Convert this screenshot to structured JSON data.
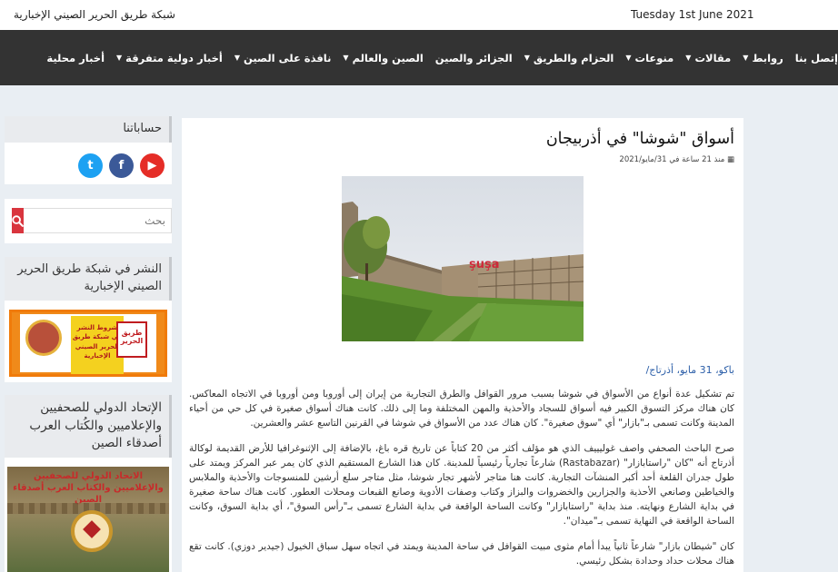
{
  "topbar": {
    "site_name": "شبكة طريق الحرير الصيني الإخبارية",
    "date": "Tuesday 1st June 2021"
  },
  "nav": [
    {
      "label": "أخبار محلية",
      "dropdown": false
    },
    {
      "label": "أخبار دولية متفرقة",
      "dropdown": true
    },
    {
      "label": "نافذة على الصين",
      "dropdown": true
    },
    {
      "label": "الصين والعالم",
      "dropdown": true
    },
    {
      "label": "الجزائر والصين",
      "dropdown": false
    },
    {
      "label": "الحزام والطريق",
      "dropdown": true
    },
    {
      "label": "منوعات",
      "dropdown": true
    },
    {
      "label": "مقالات",
      "dropdown": true
    },
    {
      "label": "روابط",
      "dropdown": true
    },
    {
      "label": "إتصل بنا",
      "dropdown": false
    }
  ],
  "sidebar": {
    "accounts_title": "حساباتنا",
    "socials": [
      {
        "name": "twitter-icon",
        "glyph": "t"
      },
      {
        "name": "facebook-icon",
        "glyph": "f"
      },
      {
        "name": "youtube-icon",
        "glyph": "▶"
      }
    ],
    "search": {
      "placeholder": "بحث"
    },
    "publish_title": "النشر في شبكة طريق الحرير الصيني الإخبارية",
    "publish_banner_text": "شروط النشر في شبكة طريق الحرير الصيني الإخبارية",
    "publish_banner_logo_text": "طريق الحرير",
    "union_title": "الإتحاد الدولي للصحفيين والإعلاميين والكُتاب العرب أصدقاء الصين",
    "union_poster_text": "الاتحاد الدولي للصحفيين والإعلاميين والكتاب العرب أصدقاء الصين"
  },
  "article": {
    "title": "أسواق \"شوشا\" في أذربيجان",
    "meta": "منذ 21 ساعة في 31/مايو/2021",
    "photo_sign": "şuşa",
    "dateline": "باكو، 31 مايو، أذرتاج/",
    "paragraphs": [
      "تم تشكيل عدة أنواع من الأسواق في شوشا بسبب مرور القوافل والطرق التجارية من إيران إلى أوروبا ومن أوروبا في الاتجاه المعاكس. كان هناك مركز التسوق الكبير فيه أسواق للسجاد والأحذية والمهن المختلفة وما إلى ذلك. كانت هناك أسواق صغيرة في كل حي من أحياء المدينة وكانت تسمى بـ\"بازار\" أي \"سوق صغيرة\". كان هناك عدد من الأسواق في شوشا في القرنين التاسع عشر والعشرين.",
      "صرح الباحث الصحفي واصف غوليييف الذي هو مؤلف أكثر من 20 كتاباً عن تاريخ قره باغ، بالإضافة إلى الإثنوغرافيا للأرض القديمة لوكالة أذرتاج أنه \"كان \"راستابازار\" (Rastabazar) شارعاً تجارياً رئيسياً للمدينة. كان هذا الشارع المستقيم الذي كان يمر عبر المركز ويمتد على طول جدران القلعة أحد أكبر المنشآت التجارية. كانت هنا متاجر لأشهر تجار شوشا، مثل متاجر سلع أرشين للمنسوجات والأحذية والملابس والخياطين وصانعي الأحذية والجزارين والخضروات والبزاز وكتاب وصفات الأدوية وصانع القبعات ومحلات العطور. كانت هناك ساحة صغيرة في بداية الشارع ونهايته. منذ بداية \"راستابازار\" وكانت الساحة الواقعة في بداية الشارع تسمى بـ\"رأس السوق\"، أي بداية السوق، وكانت الساحة الواقعة في النهاية تسمى بـ\"ميدان\".",
      "كان \"شيطان بازار\" شارعاً ثانياً يبدأ أمام مثوى مبيت القوافل في ساحة المدينة ويمتد في اتجاه سهل سباق الخيول (جيدير دوزي). كانت تقع هناك محلات حداد وحدادة بشكل رئيسي."
    ]
  },
  "colors": {
    "nav_bg": "#333333",
    "search_button": "#d9353e",
    "dateline_link": "#2b5ea8"
  }
}
